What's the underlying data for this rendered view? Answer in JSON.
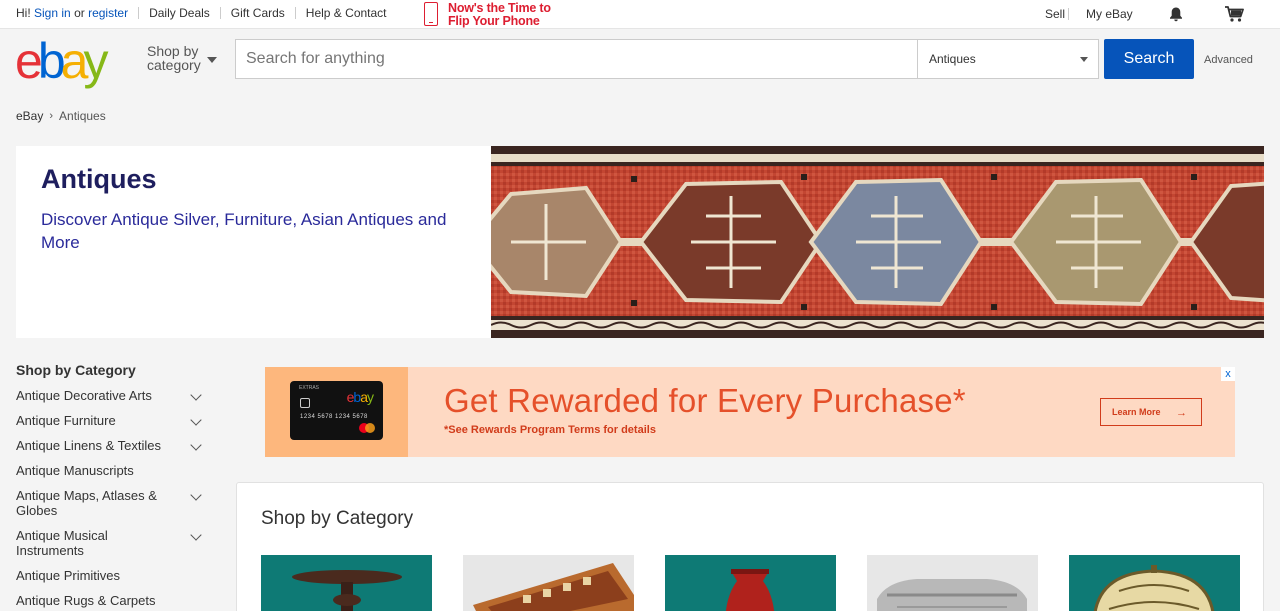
{
  "topbar": {
    "greeting": "Hi!",
    "sign_in": "Sign in",
    "or": "or",
    "register": "register",
    "daily_deals": "Daily Deals",
    "gift_cards": "Gift Cards",
    "help_contact": "Help & Contact",
    "promo_line1": "Now's the Time to",
    "promo_line2": "Flip Your Phone",
    "sell": "Sell",
    "my_ebay": "My eBay"
  },
  "header": {
    "shop_by_line1": "Shop by",
    "shop_by_line2": "category",
    "search_placeholder": "Search for anything",
    "category_selected": "Antiques",
    "search_button": "Search",
    "advanced": "Advanced"
  },
  "breadcrumb": {
    "root": "eBay",
    "current": "Antiques"
  },
  "hero": {
    "title": "Antiques",
    "subtitle": "Discover Antique Silver, Furniture, Asian Antiques and More"
  },
  "sidebar": {
    "title": "Shop by Category",
    "items": [
      {
        "label": "Antique Decorative Arts",
        "expandable": true
      },
      {
        "label": "Antique Furniture",
        "expandable": true
      },
      {
        "label": "Antique Linens & Textiles",
        "expandable": true
      },
      {
        "label": "Antique Manuscripts",
        "expandable": false
      },
      {
        "label": "Antique Maps, Atlases & Globes",
        "expandable": true
      },
      {
        "label": "Antique Musical Instruments",
        "expandable": true
      },
      {
        "label": "Antique Primitives",
        "expandable": false
      },
      {
        "label": "Antique Rugs & Carpets",
        "expandable": false
      }
    ]
  },
  "ad": {
    "headline": "Get Rewarded for Every Purchase*",
    "terms": "*See Rewards Program Terms for details",
    "button": "Learn More",
    "close": "x",
    "card_brand": "ebay",
    "card_extras": "EXTRAS",
    "card_number": "1234 5678 1234 5678"
  },
  "main": {
    "title": "Shop by Category"
  },
  "colors": {
    "link": "#0654ba",
    "search_button": "#0654ba",
    "hero_title": "#1e1e5e",
    "ad_accent": "#e5502a",
    "promo": "#dd1e31",
    "tile_teal": "#0e7a75"
  }
}
